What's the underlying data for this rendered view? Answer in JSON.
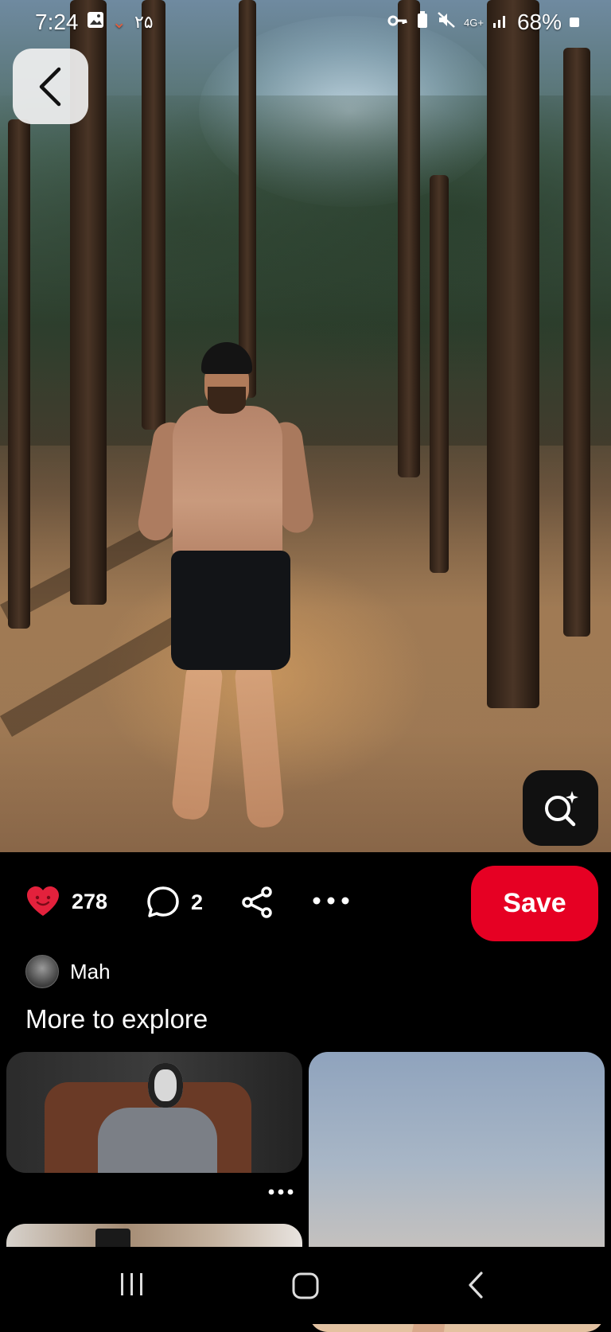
{
  "status_bar": {
    "time": "7:24",
    "date_badge": "۲۵",
    "network": "4G+",
    "battery": "68%"
  },
  "pin": {
    "likes": "278",
    "comments": "2",
    "save_label": "Save"
  },
  "author": {
    "name": "Mah"
  },
  "explore": {
    "title": "More to explore"
  },
  "icons": {
    "back": "chevron-left-icon",
    "visual_search": "lens-search-icon",
    "like": "heart-icon",
    "comment": "comment-icon",
    "share": "share-icon",
    "more": "more-icon"
  },
  "colors": {
    "accent": "#e60023",
    "background": "#000000",
    "text": "#ffffff"
  }
}
